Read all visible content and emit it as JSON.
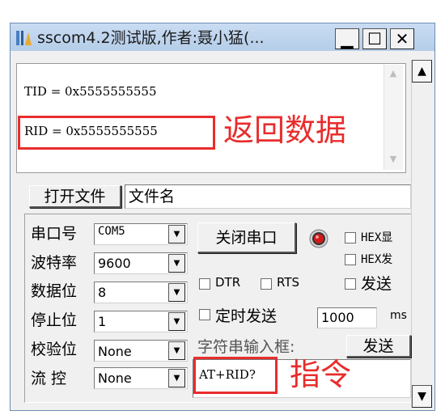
{
  "window": {
    "title": "sscom4.2测试版,作者:聂小猛(...",
    "minimize": "▁",
    "maximize": "☐",
    "close": "✕"
  },
  "receive": {
    "lines": [
      "TID = 0x5555555555",
      "RID = 0x5555555555"
    ]
  },
  "annotations": {
    "return_data": "返回数据",
    "command": "指令"
  },
  "file": {
    "open_button": "打开文件",
    "filename": "文件名"
  },
  "serial": {
    "port_label": "串口号",
    "port_value": "COM5",
    "baud_label": "波特率",
    "baud_value": "9600",
    "databits_label": "数据位",
    "databits_value": "8",
    "stopbits_label": "停止位",
    "stopbits_value": "1",
    "parity_label": "校验位",
    "parity_value": "None",
    "flow_label": "流 控",
    "flow_value": "None"
  },
  "controls": {
    "close_port_button": "关闭串口",
    "hex_display": "HEX显",
    "hex_send": "HEX发",
    "dtr": "DTR",
    "rts": "RTS",
    "send_new": "发送",
    "timed_send": "定时发送",
    "interval_value": "1000",
    "interval_unit": "ms",
    "string_input_label": "字符串输入框:",
    "send_button": "发送"
  },
  "send_input": {
    "value": "AT+RID?"
  },
  "colors": {
    "annotation": "#e82d2d",
    "title_bar": "#c9dcf2",
    "led": "#d21919"
  }
}
